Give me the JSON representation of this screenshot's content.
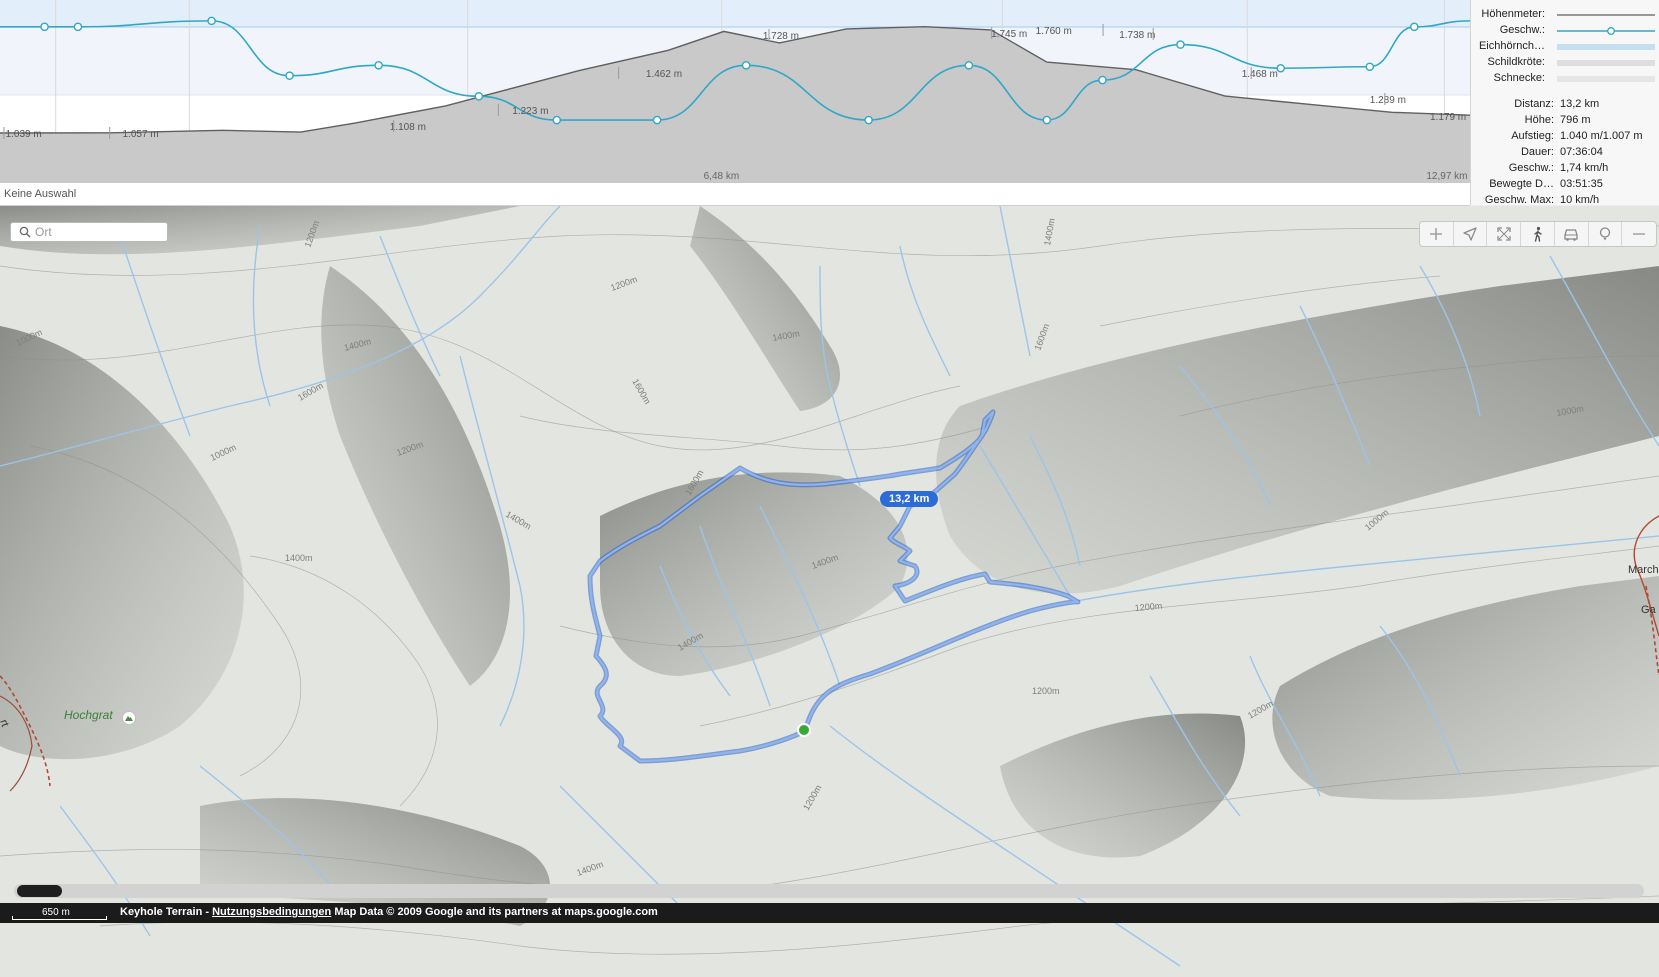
{
  "profile": {
    "status": "Keine Auswahl",
    "colors": {
      "elevation_fill": "#c9c9c9",
      "elevation_line": "#606060",
      "speed_line": "#2fa7c7",
      "band_squirrel": "#eaf1fb",
      "band_turtle": "#f3f6fb"
    },
    "height_labels": [
      "1.039 m",
      "1.057 m",
      "1.108 m",
      "1.223 m",
      "1.462 m",
      "1.728 m",
      "1.745 m",
      "1.760 m",
      "1.738 m",
      "1.468 m",
      "1.289 m",
      "1.179 m"
    ],
    "distance_labels": [
      "6,48 km",
      "12,97 km"
    ],
    "chart_data": {
      "type": "area",
      "x_range_km": [
        0,
        13.2
      ],
      "elevation": {
        "x": [
          0,
          1.0,
          2.0,
          2.7,
          3.2,
          4.0,
          5.2,
          6.0,
          6.5,
          7.0,
          7.6,
          8.3,
          8.9,
          9.4,
          10.2,
          11.0,
          11.8,
          12.5,
          13.2
        ],
        "y": [
          1039,
          1040,
          1057,
          1045,
          1108,
          1223,
          1462,
          1600,
          1728,
          1650,
          1745,
          1760,
          1738,
          1520,
          1468,
          1289,
          1230,
          1179,
          1160
        ]
      },
      "speed": {
        "x": [
          0,
          0.4,
          0.7,
          1.9,
          2.6,
          3.4,
          4.3,
          5.0,
          5.9,
          6.7,
          7.8,
          8.7,
          9.4,
          9.9,
          10.6,
          11.5,
          12.3,
          12.7,
          13.2
        ],
        "y": [
          9.0,
          9.0,
          9.0,
          9.4,
          5.7,
          6.4,
          4.3,
          2.7,
          2.7,
          6.4,
          2.7,
          6.4,
          2.7,
          5.4,
          7.8,
          6.2,
          6.3,
          9.0,
          9.4
        ],
        "y_range": [
          0,
          10
        ]
      }
    }
  },
  "legend": [
    {
      "label": "Höhenmeter:",
      "style": "line",
      "color": "#606060"
    },
    {
      "label": "Geschw.:",
      "style": "line-dot",
      "color": "#2fa7c7"
    },
    {
      "label": "Eichhörnch…",
      "style": "band",
      "color": "#c4dff0"
    },
    {
      "label": "Schildkröte:",
      "style": "band",
      "color": "#dedede"
    },
    {
      "label": "Schnecke:",
      "style": "band",
      "color": "#e6e6e6"
    }
  ],
  "stats": [
    {
      "label": "Distanz:",
      "value": "13,2 km"
    },
    {
      "label": "Höhe:",
      "value": "796 m"
    },
    {
      "label": "Aufstieg:",
      "value": "1.040 m/1.007 m"
    },
    {
      "label": "Dauer:",
      "value": "07:36:04"
    },
    {
      "label": "Geschw.:",
      "value": "1,74 km/h"
    },
    {
      "label": "Bewegte D…",
      "value": "03:51:35"
    },
    {
      "label": "Geschw. Max:",
      "value": "10 km/h"
    }
  ],
  "map": {
    "search_placeholder": "Ort",
    "place_label": "Hochgrat",
    "edge_label_right": "Marcho",
    "edge_label_right2": "Ga",
    "edge_label_left": "rt",
    "route_distance": "13,2 km",
    "contour_labels": [
      "1200m",
      "1400m",
      "1600m",
      "1000m",
      "1400m",
      "1200m",
      "1600m",
      "1400m",
      "1000m",
      "1200m",
      "1400m",
      "1200m",
      "1000m",
      "1400m",
      "1600m",
      "1400m",
      "1200m",
      "1400m",
      "1000m",
      "1200m",
      "1400m",
      "1600m",
      "1200m"
    ],
    "colors": {
      "route": "#5b8fe3",
      "route_outline": "#2e62c0",
      "water": "#9cc4ea",
      "trail": "#b04a37",
      "terrain": "#e3e6e0"
    },
    "toolbar": [
      {
        "name": "zoom-in-icon"
      },
      {
        "name": "location-arrow-icon"
      },
      {
        "name": "fullscreen-icon"
      },
      {
        "name": "walking-person-icon"
      },
      {
        "name": "car-icon"
      },
      {
        "name": "balloon-icon"
      },
      {
        "name": "zoom-out-icon"
      }
    ]
  },
  "footer": {
    "scale": "650 m",
    "attribution_prefix": "Keyhole Terrain - ",
    "terms_link": "Nutzungsbedingungen",
    "attribution_suffix": " Map Data © 2009 Google and its partners at maps.google.com"
  }
}
